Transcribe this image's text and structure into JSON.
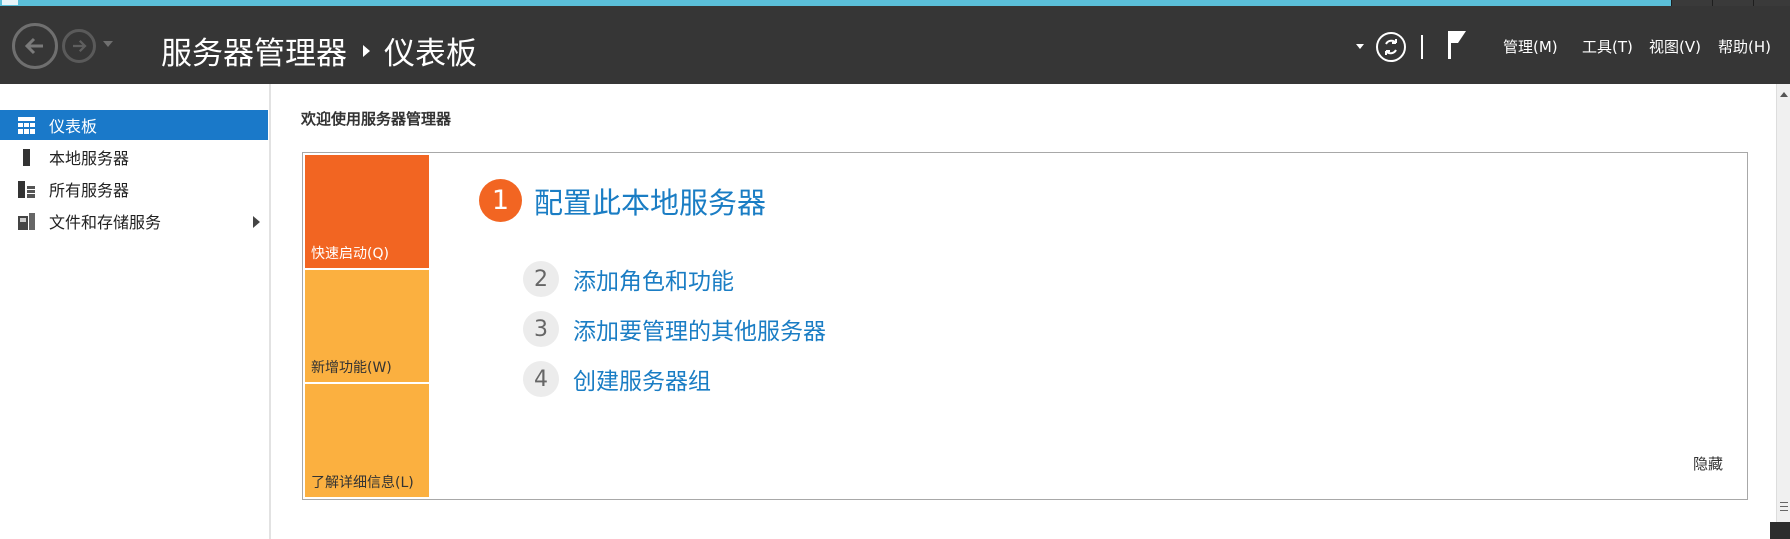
{
  "header": {
    "breadcrumb_root": "服务器管理器",
    "breadcrumb_current": "仪表板",
    "menus": [
      "管理(M)",
      "工具(T)",
      "视图(V)",
      "帮助(H)"
    ]
  },
  "sidebar": {
    "items": [
      {
        "label": "仪表板",
        "icon": "dashboard-icon",
        "active": true
      },
      {
        "label": "本地服务器",
        "icon": "local-server-icon"
      },
      {
        "label": "所有服务器",
        "icon": "all-servers-icon"
      },
      {
        "label": "文件和存储服务",
        "icon": "file-storage-icon",
        "has_submenu": true
      }
    ]
  },
  "main": {
    "welcome": "欢迎使用服务器管理器",
    "tiles": [
      "快速启动(Q)",
      "新增功能(W)",
      "了解详细信息(L)"
    ],
    "steps": [
      {
        "num": "1",
        "label": "配置此本地服务器"
      },
      {
        "num": "2",
        "label": "添加角色和功能"
      },
      {
        "num": "3",
        "label": "添加要管理的其他服务器"
      },
      {
        "num": "4",
        "label": "创建服务器组"
      }
    ],
    "hide_label": "隐藏"
  },
  "colors": {
    "header_bg": "#363636",
    "accent_blue": "#1a79c9",
    "orange": "#f26522",
    "light_orange": "#fbb040",
    "link": "#1a7dc4"
  }
}
